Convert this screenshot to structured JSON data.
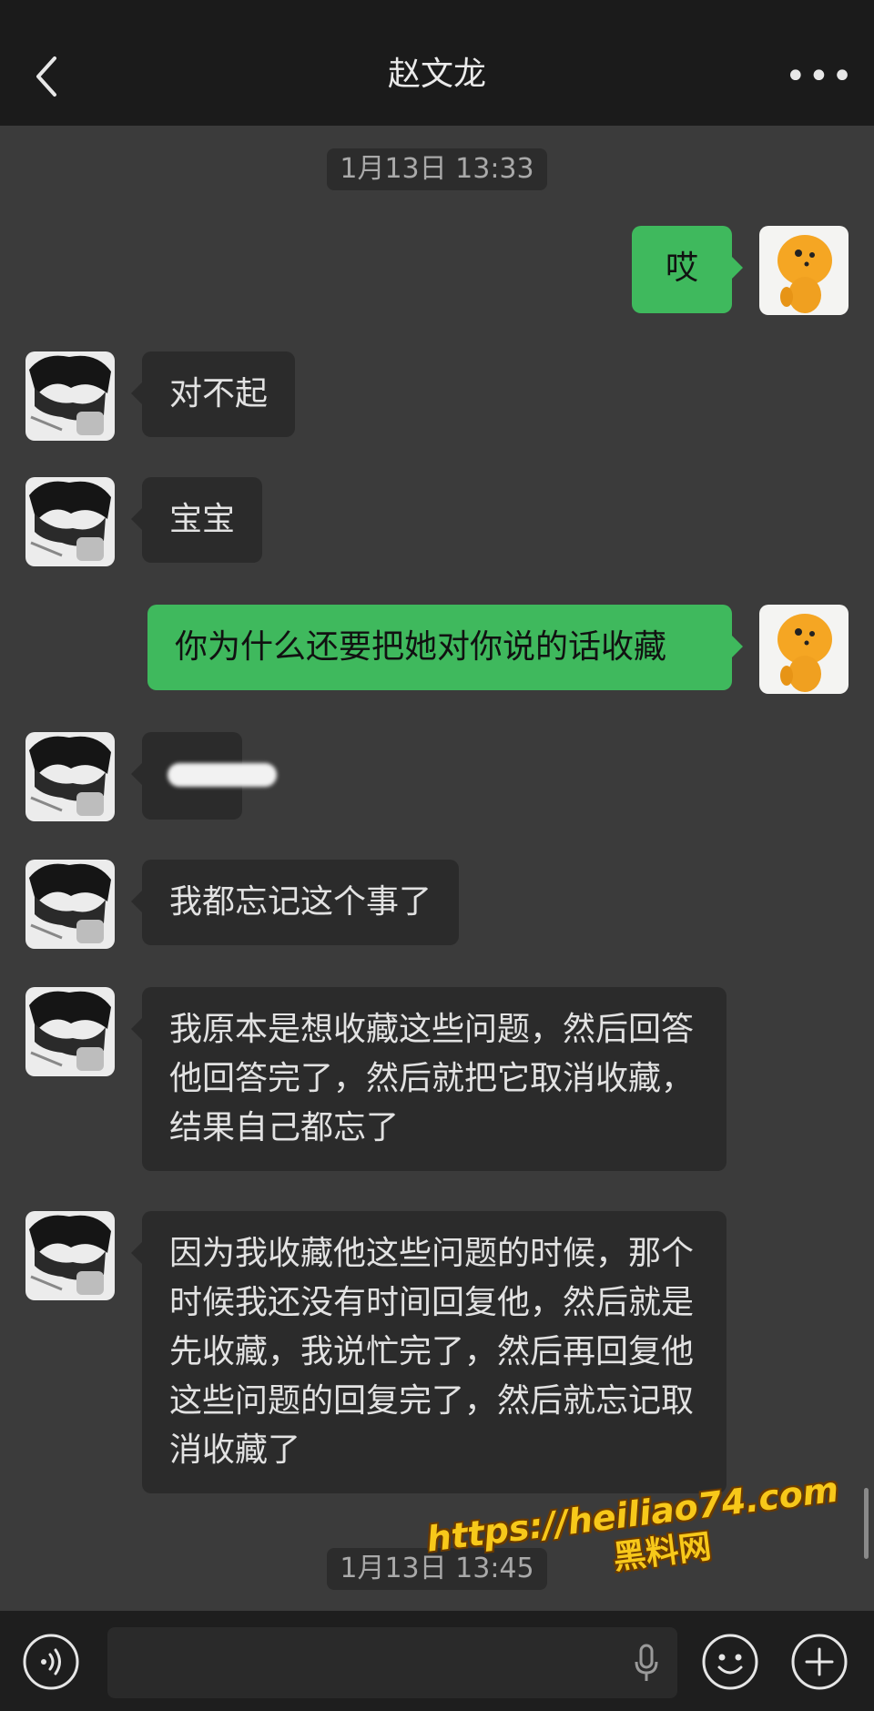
{
  "header": {
    "title": "赵文龙",
    "back_icon": "chevron-left-icon",
    "more_label": "•••"
  },
  "timestamps": [
    "1月13日 13:33",
    "1月13日 13:45"
  ],
  "messages": [
    {
      "sender": "me",
      "text": "哎"
    },
    {
      "sender": "contact",
      "text": "对不起"
    },
    {
      "sender": "contact",
      "text": "宝宝"
    },
    {
      "sender": "me",
      "text": "你为什么还要把她对你说的话收藏"
    },
    {
      "sender": "contact",
      "text": ""
    },
    {
      "sender": "contact",
      "text": "我都忘记这个事了"
    },
    {
      "sender": "contact",
      "text": "我原本是想收藏这些问题，然后回答他回答完了，然后就把它取消收藏，结果自己都忘了"
    },
    {
      "sender": "contact",
      "text": "因为我收藏他这些问题的时候，那个时候我还没有时间回复他，然后就是先收藏，我说忙完了，然后再回复他这些问题的回复完了，然后就忘记取消收藏了"
    }
  ],
  "input_bar": {
    "voice_icon": "voice-mode-icon",
    "mic_icon": "microphone-icon",
    "emoji_icon": "emoji-icon",
    "add_icon": "plus-circle-icon"
  },
  "watermark": {
    "line1": "https://heiliao74.com",
    "line2": "黑料网"
  },
  "colors": {
    "background": "#3b3b3b",
    "header": "#1b1b1b",
    "incoming_bubble": "#2b2b2b",
    "outgoing_bubble": "#3fb95d",
    "watermark": "#f7c81a"
  }
}
